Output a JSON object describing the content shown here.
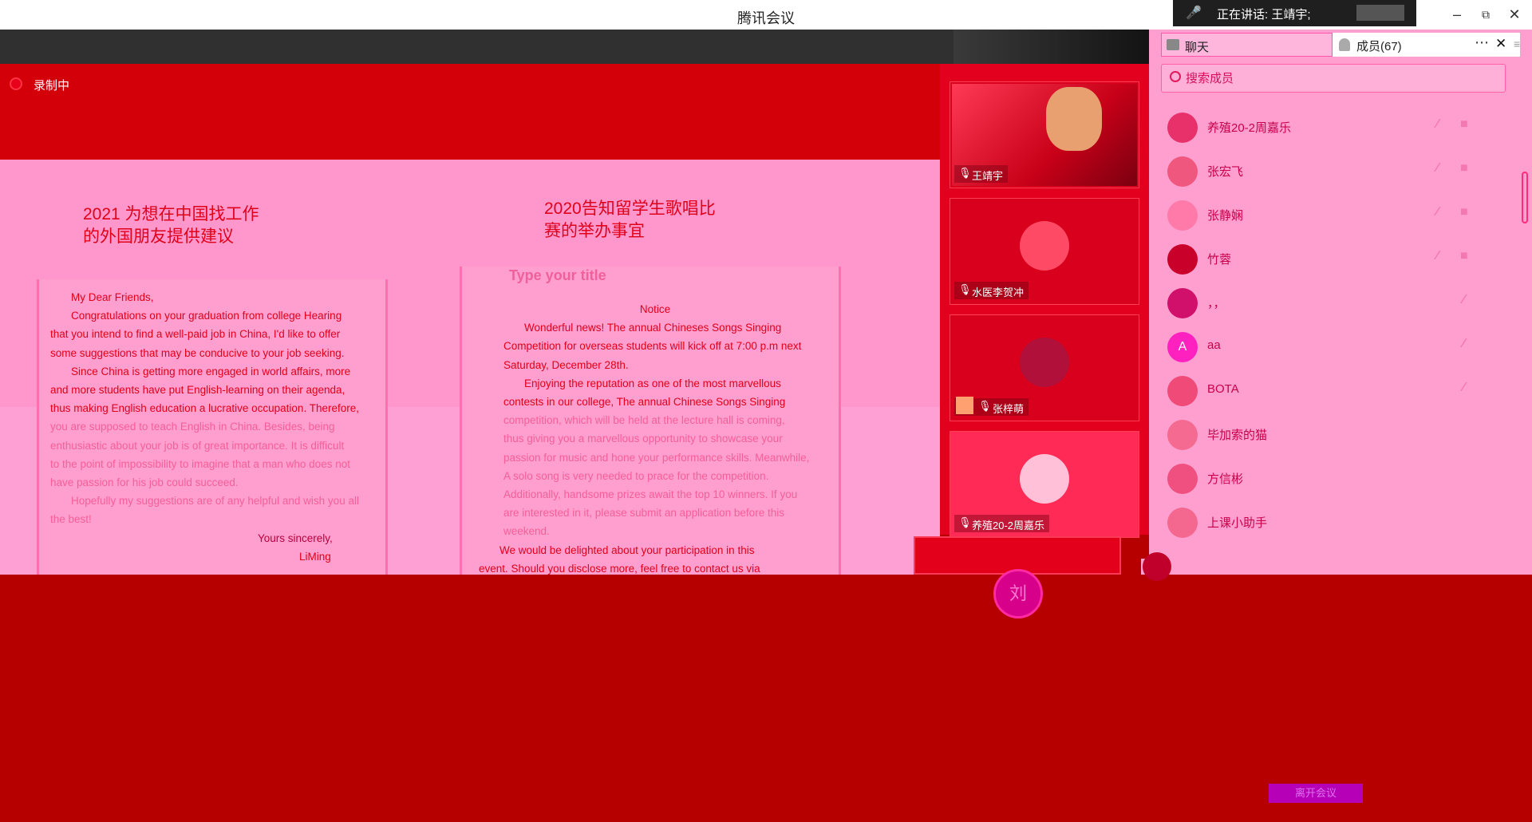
{
  "app": {
    "title": "腾讯会议",
    "speaking": "正在讲话: 王靖宇;"
  },
  "recording": {
    "label": "录制中"
  },
  "slide": {
    "left_heading_1": "2021 为想在中国找工作",
    "left_heading_2": "的外国朋友提供建议",
    "right_heading_1": "2020告知留学生歌唱比",
    "right_heading_2": "赛的举办事宜",
    "left_letter": {
      "greeting": "My Dear Friends,",
      "p1_l1": "Congratulations on your graduation from college Hearing",
      "p1_l2": "that you intend to find a well-paid job in China, I'd like to offer",
      "p1_l3": "some suggestions that may be conducive to your job seeking.",
      "p2_l1": "Since China is getting more engaged in world affairs, more",
      "p2_l2": "and more students have put English-learning on their agenda,",
      "p2_l3": "thus making English education a lucrative occupation. Therefore,",
      "p2_l4": "you are supposed to teach English in China. Besides, being",
      "p2_l5": "enthusiastic about your job is of great importance. It is difficult",
      "p2_l6": "to the point of impossibility to imagine that a man who does not",
      "p2_l7": "have passion for his job could succeed.",
      "p3_l1": "Hopefully my suggestions are of any helpful and wish you all",
      "p3_l2": "the best!",
      "closing": "Yours sincerely,",
      "signature": "LiMing"
    },
    "right_notice": {
      "placeholder_title": "Type your title",
      "heading": "Notice",
      "l1": "Wonderful news! The annual Chineses Songs Singing",
      "l2": "Competition for overseas students will kick off at 7:00 p.m next",
      "l3": "Saturday, December 28th.",
      "l4": "Enjoying the reputation as one of the most marvellous",
      "l5": "contests in our college, The annual Chinese Songs Singing",
      "l6": "competition, which will be held at the lecture hall is coming,",
      "l7": "thus giving you a marvellous opportunity to showcase your",
      "l8": "passion for music and hone your performance skills. Meanwhile,",
      "l9": "A solo song is very needed to prace for the competition.",
      "l10": "Additionally, handsome prizes await the top 10 winners. If you",
      "l11": "are interested in it, please submit an application before this",
      "l12": "weekend.",
      "l13": "We would be delighted about your participation in this",
      "l14": "event. Should you disclose more, feel free to contact us via"
    }
  },
  "video_tiles": [
    {
      "name": "王靖宇"
    },
    {
      "name": "水医李贺冲"
    },
    {
      "name": "张梓萌"
    },
    {
      "name": "养殖20-2周嘉乐"
    }
  ],
  "self_view": {
    "avatar_text": "刘"
  },
  "panel": {
    "tab_chat": "聊天",
    "tab_members": "成员(67)",
    "search_placeholder": "搜索成员",
    "members": [
      {
        "name": "养殖20-2周嘉乐",
        "avatar": "",
        "color": "#e8306a"
      },
      {
        "name": "张宏飞",
        "avatar": "",
        "color": "#f0577e"
      },
      {
        "name": "张静娴",
        "avatar": "",
        "color": "#ff7aa8"
      },
      {
        "name": "竹蓉",
        "avatar": "",
        "color": "#c8002a"
      },
      {
        "name": "，，",
        "avatar": "",
        "color": "#d0106a"
      },
      {
        "name": "aa",
        "avatar": "A",
        "color": "#ff20c0"
      },
      {
        "name": "BOTA",
        "avatar": "",
        "color": "#f04a78"
      },
      {
        "name": "毕加索的猫",
        "avatar": "",
        "color": "#f46a90"
      },
      {
        "name": "方信彬",
        "avatar": "",
        "color": "#f05080"
      },
      {
        "name": "上课小助手",
        "avatar": "",
        "color": "#f46890"
      }
    ]
  },
  "bottom": {
    "exit_label": "离开会议"
  },
  "icons": {
    "mic_muted": "mic-muted-icon",
    "camera_off": "camera-off-icon",
    "search": "search-icon",
    "more": "more-icon",
    "close": "close-icon"
  }
}
